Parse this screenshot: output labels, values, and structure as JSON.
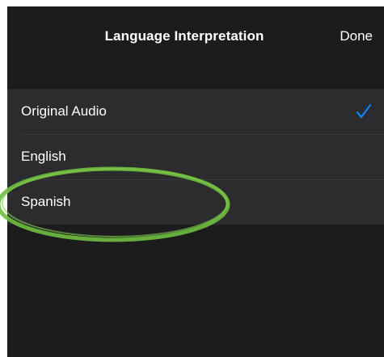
{
  "nav": {
    "title": "Language Interpretation",
    "done_label": "Done"
  },
  "options": [
    {
      "label": "Original Audio",
      "selected": true
    },
    {
      "label": "English",
      "selected": false
    },
    {
      "label": "Spanish",
      "selected": false
    }
  ],
  "colors": {
    "background": "#1c1c1e",
    "row_background": "#2c2c2e",
    "separator": "#3a3a3c",
    "checkmark": "#0a84ff",
    "highlight_annotation": "#6fbf3f"
  },
  "icons": {
    "selected_indicator": "checkmark-icon"
  }
}
